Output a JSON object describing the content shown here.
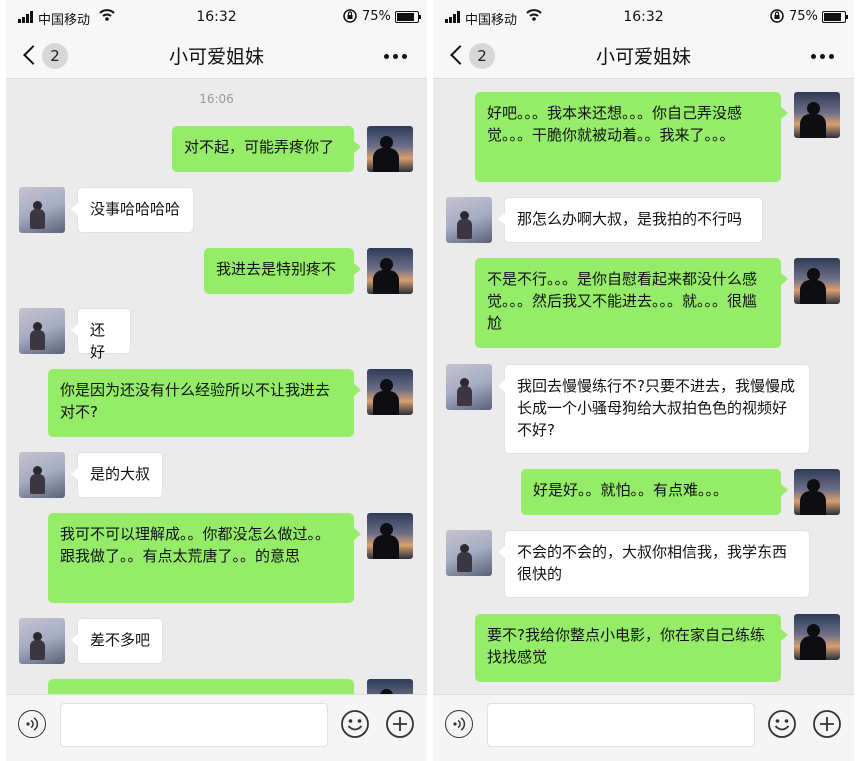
{
  "status_bar": {
    "carrier": "中国移动",
    "time": "16:32",
    "battery": "75%",
    "battery_level": 0.75
  },
  "nav": {
    "back_count": "2",
    "title": "小可爱姐妹"
  },
  "left_timestamp": "16:06",
  "left_messages": [
    {
      "from": "me",
      "text": "对不起，可能弄疼你了"
    },
    {
      "from": "her",
      "text": "没事哈哈哈哈"
    },
    {
      "from": "me",
      "text": "我进去是特别疼不"
    },
    {
      "from": "her",
      "text": "还好"
    },
    {
      "from": "me",
      "text": "你是因为还没有什么经验所以不让我进去对不?"
    },
    {
      "from": "her",
      "text": "是的大叔"
    },
    {
      "from": "me",
      "text": "我可不可以理解成。。你都没怎么做过。。跟我做了。。有点太荒唐了。。的意思"
    },
    {
      "from": "her",
      "text": "差不多吧"
    }
  ],
  "right_messages": [
    {
      "from": "me",
      "text": "好吧。。。我本来还想。。。你自己弄没感觉。。。干脆你就被动着。。我来了。。。"
    },
    {
      "from": "her",
      "text": "那怎么办啊大叔，是我拍的不行吗"
    },
    {
      "from": "me",
      "text": "不是不行。。。是你自慰看起来都没什么感觉。。。然后我又不能进去。。。就。。。很尴尬"
    },
    {
      "from": "her",
      "text": "我回去慢慢练行不?只要不进去，我慢慢成长成一个小骚母狗给大叔拍色色的视频好不好?"
    },
    {
      "from": "me",
      "text": "好是好。。就怕。。有点难。。。"
    },
    {
      "from": "her",
      "text": "不会的不会的，大叔你相信我，我学东西很快的"
    },
    {
      "from": "me",
      "text": "要不?我给你整点小电影，你在家自己练练找找感觉"
    }
  ],
  "icons": [
    "signal-icon",
    "wifi-icon",
    "lock-icon",
    "battery-icon",
    "back-chevron-icon",
    "more-icon",
    "voice-icon",
    "emoji-icon",
    "plus-icon"
  ]
}
